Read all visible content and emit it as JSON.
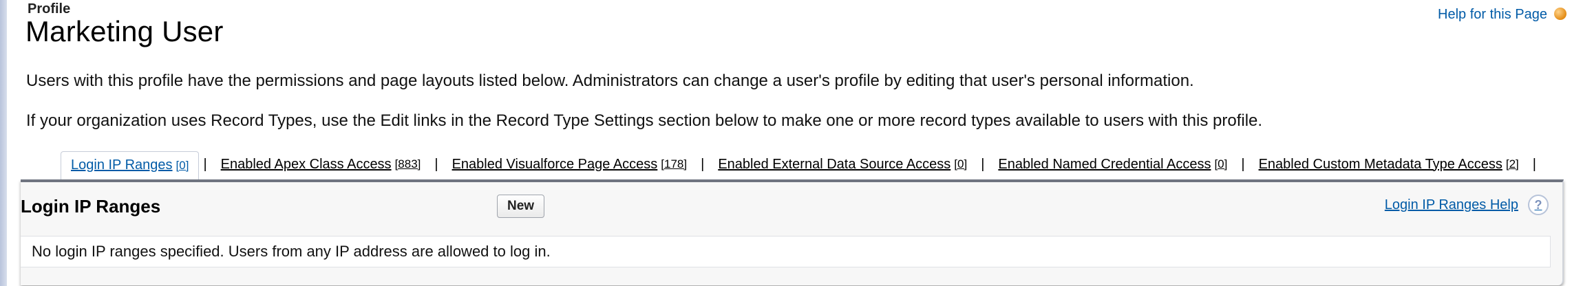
{
  "header": {
    "section": "Profile",
    "title": "Marketing User",
    "help_link": "Help for this Page"
  },
  "descriptions": [
    "Users with this profile have the permissions and page layouts listed below. Administrators can change a user's profile by editing that user's personal information.",
    "If your organization uses Record Types, use the Edit links in the Record Type Settings section below to make one or more record types available to users with this profile."
  ],
  "tabs": [
    {
      "label": "Login IP Ranges",
      "count": "[0]",
      "active": true
    },
    {
      "label": "Enabled Apex Class Access",
      "count": "[883]",
      "active": false
    },
    {
      "label": "Enabled Visualforce Page Access",
      "count": "[178]",
      "active": false
    },
    {
      "label": "Enabled External Data Source Access",
      "count": "[0]",
      "active": false
    },
    {
      "label": "Enabled Named Credential Access",
      "count": "[0]",
      "active": false
    },
    {
      "label": "Enabled Custom Metadata Type Access",
      "count": "[2]",
      "active": false
    }
  ],
  "tab_separator": "|",
  "panel": {
    "title": "Login IP Ranges",
    "new_button": "New",
    "help_link": "Login IP Ranges Help",
    "help_icon": "?",
    "message": "No login IP ranges specified. Users from any IP address are allowed to log in."
  },
  "colors": {
    "link": "#015ba7",
    "panel_border": "#6f7480"
  }
}
